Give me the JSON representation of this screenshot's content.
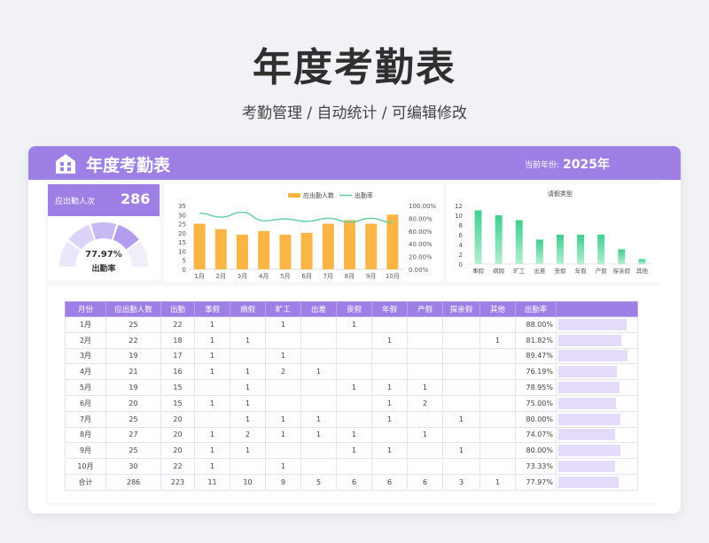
{
  "page": {
    "title": "年度考勤表",
    "subtitle": "考勤管理 /  自动统计  /  可编辑修改"
  },
  "header": {
    "title": "年度考勤表",
    "year_label": "当前年份:",
    "year_value": "2025年",
    "icon": "building-icon"
  },
  "kpi": {
    "label": "应出勤人次",
    "value": "286",
    "rate": "77.97%",
    "rate_label": "出勤率",
    "rate_fraction": 0.7797
  },
  "colors": {
    "accent": "#9d7fe6",
    "bar_orange": "#fbb545",
    "line_green": "#5ccda0",
    "bar_green": "#4dcf93",
    "rate_bar": "#e5dcfb"
  },
  "chart_data": [
    {
      "type": "bar",
      "legend": [
        "应出勤人数",
        "出勤率"
      ],
      "categories": [
        "1月",
        "2月",
        "3月",
        "4月",
        "5月",
        "6月",
        "7月",
        "8月",
        "9月",
        "10月"
      ],
      "series": [
        {
          "name": "应出勤人数",
          "type": "bar",
          "values": [
            25,
            22,
            19,
            21,
            19,
            20,
            25,
            27,
            25,
            30
          ]
        },
        {
          "name": "出勤率",
          "type": "line",
          "values": [
            88.0,
            81.82,
            89.47,
            76.19,
            78.95,
            75.0,
            80.0,
            74.07,
            80.0,
            73.33
          ]
        }
      ],
      "y_ticks": [
        "35",
        "30",
        "25",
        "20",
        "15",
        "10",
        "5",
        "0"
      ],
      "y2_ticks": [
        "100.00%",
        "80.00%",
        "60.00%",
        "40.00%",
        "20.00%",
        "0.00%"
      ],
      "ylim": [
        0,
        35
      ],
      "y2lim": [
        0,
        100
      ]
    },
    {
      "type": "bar",
      "title": "请假类型",
      "categories": [
        "事假",
        "病假",
        "旷工",
        "出差",
        "丧假",
        "年假",
        "产假",
        "探亲假",
        "其他"
      ],
      "values": [
        11,
        10,
        9,
        5,
        6,
        6,
        6,
        3,
        1
      ],
      "y_ticks": [
        "12",
        "10",
        "8",
        "6",
        "4",
        "2",
        "0"
      ],
      "ylim": [
        0,
        12
      ]
    }
  ],
  "table": {
    "headers": [
      "月份",
      "应出勤人数",
      "出勤",
      "事假",
      "病假",
      "旷工",
      "出差",
      "丧假",
      "年假",
      "产假",
      "探亲假",
      "其他",
      "出勤率",
      ""
    ],
    "rows": [
      [
        "1月",
        "25",
        "22",
        "1",
        "",
        "1",
        "",
        "1",
        "",
        "",
        "",
        "",
        "88.00%"
      ],
      [
        "2月",
        "22",
        "18",
        "1",
        "1",
        "",
        "",
        "",
        "1",
        "",
        "",
        "1",
        "81.82%"
      ],
      [
        "3月",
        "19",
        "17",
        "1",
        "",
        "1",
        "",
        "",
        "",
        "",
        "",
        "",
        "89.47%"
      ],
      [
        "4月",
        "21",
        "16",
        "1",
        "1",
        "2",
        "1",
        "",
        "",
        "",
        "",
        "",
        "76.19%"
      ],
      [
        "5月",
        "19",
        "15",
        "",
        "1",
        "",
        "",
        "1",
        "1",
        "1",
        "",
        "",
        "78.95%"
      ],
      [
        "6月",
        "20",
        "15",
        "1",
        "1",
        "",
        "",
        "",
        "1",
        "2",
        "",
        "",
        "75.00%"
      ],
      [
        "7月",
        "25",
        "20",
        "",
        "1",
        "1",
        "1",
        "",
        "1",
        "",
        "1",
        "",
        "80.00%"
      ],
      [
        "8月",
        "27",
        "20",
        "1",
        "2",
        "1",
        "1",
        "1",
        "",
        "1",
        "",
        "",
        "74.07%"
      ],
      [
        "9月",
        "25",
        "20",
        "1",
        "1",
        "",
        "",
        "1",
        "1",
        "",
        "1",
        "",
        "80.00%"
      ],
      [
        "10月",
        "30",
        "22",
        "1",
        "",
        "1",
        "",
        "",
        "",
        "",
        "",
        "",
        "73.33%"
      ],
      [
        "合计",
        "286",
        "223",
        "11",
        "10",
        "9",
        "5",
        "6",
        "6",
        "6",
        "3",
        "1",
        "77.97%"
      ]
    ],
    "rates": [
      0.88,
      0.8182,
      0.8947,
      0.7619,
      0.7895,
      0.75,
      0.8,
      0.7407,
      0.8,
      0.7333,
      0.7797
    ]
  }
}
